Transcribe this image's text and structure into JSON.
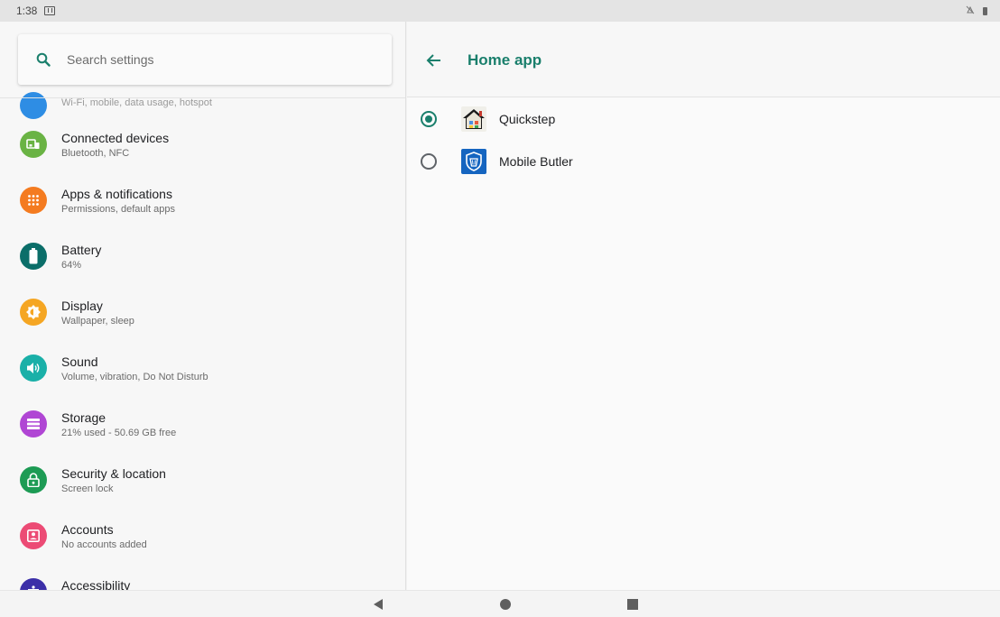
{
  "status_bar": {
    "time": "1:38",
    "icons": [
      "notification-icon",
      "alarm-off-icon",
      "battery-icon"
    ]
  },
  "search": {
    "placeholder": "Search settings"
  },
  "settings": {
    "partial_top_summary": "Wi-Fi, mobile, data usage, hotspot",
    "items": [
      {
        "title": "Connected devices",
        "summary": "Bluetooth, NFC",
        "icon": "devices-icon",
        "color": "#6ab344"
      },
      {
        "title": "Apps & notifications",
        "summary": "Permissions, default apps",
        "icon": "apps-icon",
        "color": "#f47b20"
      },
      {
        "title": "Battery",
        "summary": "64%",
        "icon": "battery-icon",
        "color": "#0b6e69"
      },
      {
        "title": "Display",
        "summary": "Wallpaper, sleep",
        "icon": "brightness-icon",
        "color": "#f5a623"
      },
      {
        "title": "Sound",
        "summary": "Volume, vibration, Do Not Disturb",
        "icon": "volume-icon",
        "color": "#1ab0a8"
      },
      {
        "title": "Storage",
        "summary": "21% used - 50.69 GB free",
        "icon": "storage-icon",
        "color": "#b046d4"
      },
      {
        "title": "Security & location",
        "summary": "Screen lock",
        "icon": "lock-icon",
        "color": "#1d9b54"
      },
      {
        "title": "Accounts",
        "summary": "No accounts added",
        "icon": "account-icon",
        "color": "#ec4b75"
      },
      {
        "title": "Accessibility",
        "summary": "",
        "icon": "accessibility-icon",
        "color": "#3c2fa8"
      }
    ]
  },
  "home_app": {
    "title": "Home app",
    "options": [
      {
        "label": "Quickstep",
        "selected": true,
        "icon": "quickstep-icon"
      },
      {
        "label": "Mobile Butler",
        "selected": false,
        "icon": "mobile-butler-icon"
      }
    ]
  },
  "colors": {
    "accent": "#1a7f6c",
    "radio_unselected": "#5f6368"
  }
}
